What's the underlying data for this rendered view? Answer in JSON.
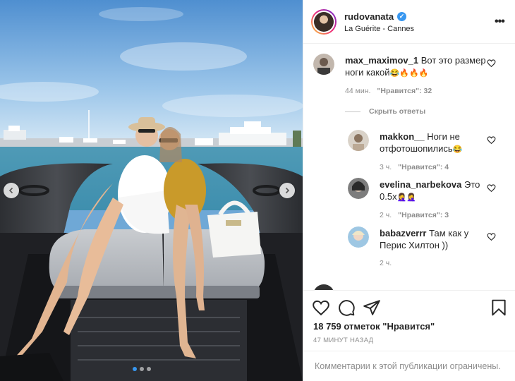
{
  "post": {
    "username": "rudovanata",
    "location": "La Guérite - Cannes",
    "more_icon": "more-horizontal-icon",
    "verified_icon": "verified-badge-icon",
    "likes_text": "18 759 отметок \"Нравится\"",
    "time_ago": "47 МИНУТ НАЗАД",
    "comments_limited": "Комментарии к этой публикации ограничены."
  },
  "photo": {
    "slide_count": 3,
    "active_slide": 1,
    "prev_icon": "chevron-left-icon",
    "next_icon": "chevron-right-icon"
  },
  "comments": [
    {
      "username": "max_maximov_1",
      "text": "Вот это размер ноги какой",
      "emojis": "😂🔥🔥🔥",
      "time": "44 мин.",
      "likes": "\"Нравится\": 32",
      "is_reply": false
    }
  ],
  "hide_replies": "Скрыть ответы",
  "replies": [
    {
      "username": "makkon__",
      "text": "Ноги не отфотошопились",
      "emojis": "😂",
      "time": "3 ч.",
      "likes": "\"Нравится\": 4"
    },
    {
      "username": "evelina_narbekova",
      "text": "Это 0.5х",
      "emojis": "🤦‍♀️🤦‍♀️",
      "time": "2 ч.",
      "likes": "\"Нравится\": 3"
    },
    {
      "username": "babazverrr",
      "text": "Там как у Перис Хилтон ))",
      "emojis": "",
      "time": "2 ч.",
      "likes": ""
    }
  ],
  "actions": {
    "like_icon": "heart-icon",
    "comment_icon": "comment-icon",
    "share_icon": "share-icon",
    "save_icon": "bookmark-icon"
  },
  "colors": {
    "accent": "#3897f0",
    "muted": "#8e8e8e",
    "text": "#262626",
    "border": "#efefef"
  }
}
